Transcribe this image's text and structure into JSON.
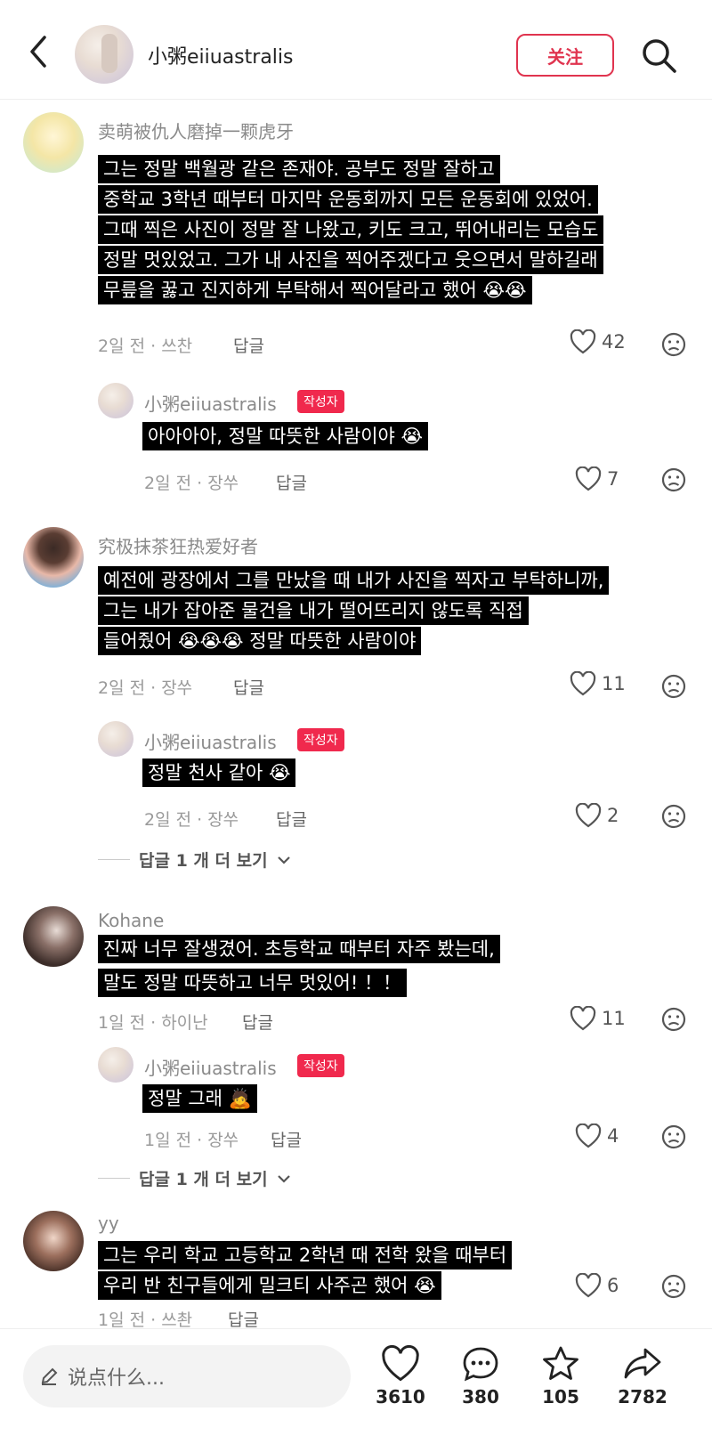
{
  "header": {
    "author_name": "小粥eiiuastralis",
    "follow_label": "关注"
  },
  "author_tag": "작성자",
  "comments": [
    {
      "name": "卖萌被仇人磨掉一颗虎牙",
      "lines": [
        "그는 정말 백월광 같은 존재야. 공부도 정말 잘하고",
        "중학교 3학년 때부터 마지막 운동회까지 모든 운동회에 있었어.",
        "그때 찍은 사진이 정말 잘 나왔고, 키도 크고, 뛰어내리는 모습도",
        "정말 멋있었고. 그가 내 사진을 찍어주겠다고 웃으면서 말하길래",
        "무릎을 꿇고 진지하게 부탁해서 찍어달라고 했어 😭😭"
      ],
      "meta": "2일 전 · 쓰찬",
      "reply": "답글",
      "likes": "42",
      "author_reply": {
        "name": "小粥eiiuastralis",
        "text": "아아아아, 정말 따뜻한 사람이야 😭",
        "meta": "2일 전 · 장쑤",
        "reply": "답글",
        "likes": "7"
      }
    },
    {
      "name": "究极抹茶狂热爱好者",
      "lines": [
        "예전에 광장에서 그를 만났을 때 내가 사진을 찍자고 부탁하니까,",
        "그는 내가 잡아준 물건을 내가 떨어뜨리지 않도록 직접",
        "들어줬어 😭😭😭 정말 따뜻한 사람이야"
      ],
      "meta": "2일 전 · 장쑤",
      "reply": "답글",
      "likes": "11",
      "author_reply": {
        "name": "小粥eiiuastralis",
        "text": "정말 천사 같아 😭",
        "meta": "2일 전 · 장쑤",
        "reply": "답글",
        "likes": "2"
      },
      "more": "답글 1 개 더 보기"
    },
    {
      "name": "Kohane",
      "lines": [
        "진짜 너무 잘생겼어. 초등학교 때부터 자주 봤는데,",
        "말도 정말 따뜻하고 너무 멋있어! ！！"
      ],
      "meta": "1일 전 · 하이난",
      "reply": "답글",
      "likes": "11",
      "author_reply": {
        "name": "小粥eiiuastralis",
        "text": "정말 그래 🙇",
        "meta": "1일 전 · 장쑤",
        "reply": "답글",
        "likes": "4"
      },
      "more": "답글 1 개 더 보기"
    },
    {
      "name": "yy",
      "lines": [
        "그는 우리 학교 고등학교 2학년 때 전학 왔을 때부터",
        "우리 반 친구들에게 밀크티 사주곤 했어 😭"
      ],
      "meta": "1일 전 · 쓰촨",
      "reply": "답글",
      "likes": "6"
    }
  ],
  "bottom_bar": {
    "input_placeholder": "说点什么...",
    "likes": "3610",
    "comments": "380",
    "favorites": "105",
    "shares": "2782"
  }
}
